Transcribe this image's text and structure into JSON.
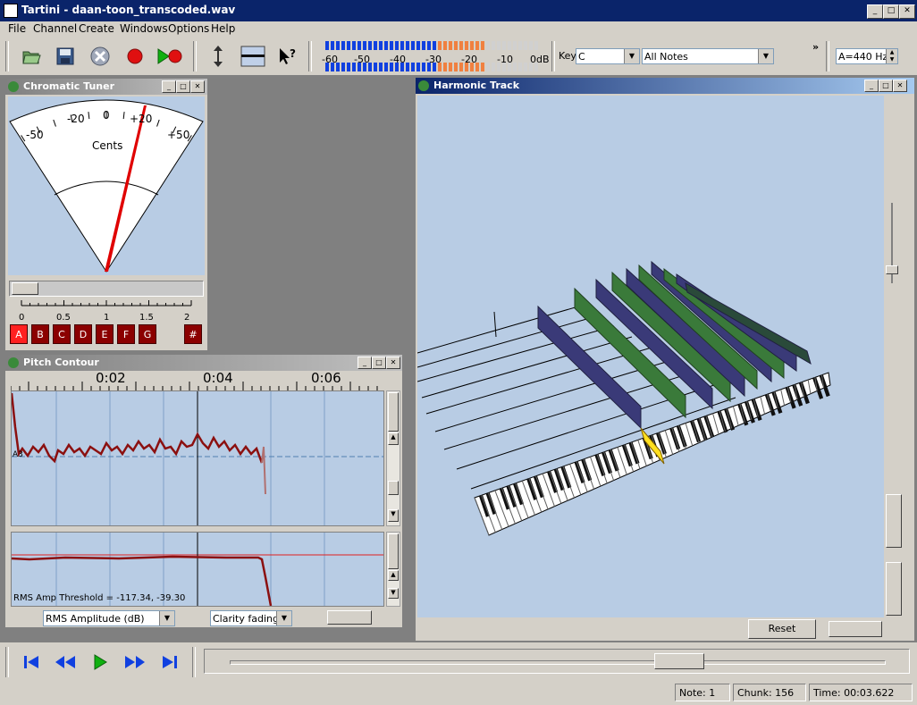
{
  "window": {
    "title": "Tartini - daan-toon_transcoded.wav"
  },
  "menu": [
    "File",
    "Channel",
    "Create",
    "Windows",
    "Options",
    "Help"
  ],
  "toolbar": {
    "buttons": [
      "open-icon",
      "save-icon",
      "close-icon",
      "record-icon",
      "play-record-icon",
      "auto-follow-icon",
      "shading-icon",
      "whats-this-icon"
    ],
    "meter_labels": [
      "-60",
      "-50",
      "-40",
      "-30",
      "-20",
      "-10",
      "0dB"
    ],
    "key_label": "Key",
    "key_value": "C",
    "scale_value": "All Notes",
    "more_label": "»",
    "tuning_value": "A=440 Hz"
  },
  "tuner": {
    "title": "Chromatic Tuner",
    "scale_labels": [
      "-50",
      "-20",
      "0",
      "+20",
      "+50"
    ],
    "cents_label": "Cents",
    "slider_ticks": [
      "0",
      "0.5",
      "1",
      "1.5",
      "2"
    ],
    "notes": [
      "A",
      "B",
      "C",
      "D",
      "E",
      "F",
      "G"
    ],
    "sharp": "#",
    "selected_note": "A"
  },
  "pitch_contour": {
    "title": "Pitch Contour",
    "time_labels": [
      "0:02",
      "0:04",
      "0:06"
    ],
    "note_label": "A3",
    "threshold_text": "RMS Amp Threshold = -117.34, -39.30",
    "amp_mode": "RMS Amplitude (dB)",
    "fade_mode": "Clarity fading"
  },
  "harmonic_track": {
    "title": "Harmonic Track",
    "reset_label": "Reset"
  },
  "status": {
    "note": "Note: 1",
    "chunk": "Chunk: 156",
    "time": "Time: 00:03.622"
  },
  "colors": {
    "title_active": "#0a246a",
    "plot_bg": "#b8cce4",
    "contour": "#8b1010",
    "note_red": "#8b0000",
    "needle": "#e00000"
  }
}
